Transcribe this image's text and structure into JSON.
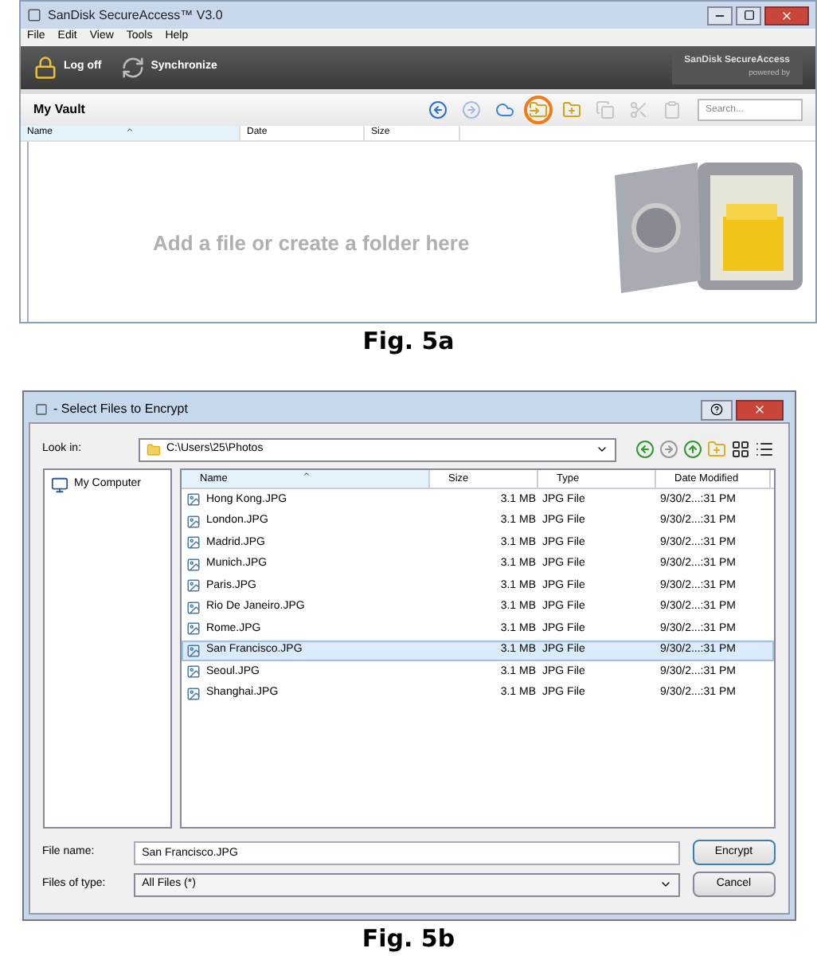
{
  "fig_a": {
    "window": {
      "title": "SanDisk SecureAccess™ V3.0"
    },
    "menu": [
      "File",
      "Edit",
      "View",
      "Tools",
      "Help"
    ],
    "toolbar": [
      {
        "label": "Log off",
        "kind": "lock"
      },
      {
        "label": "Synchronize",
        "kind": "sync"
      }
    ],
    "brand": {
      "name": "SanDisk SecureAccess",
      "tagline": "powered by"
    },
    "vault": {
      "title": "My Vault",
      "tools": [
        {
          "kind": "back",
          "disabled": false,
          "highlighted": false
        },
        {
          "kind": "forward",
          "disabled": true,
          "highlighted": false
        },
        {
          "kind": "cloud",
          "disabled": false,
          "highlighted": false
        },
        {
          "kind": "folder_add",
          "disabled": false,
          "highlighted": true
        },
        {
          "kind": "folder_new",
          "disabled": false,
          "highlighted": false
        },
        {
          "kind": "copy",
          "disabled": true,
          "highlighted": false
        },
        {
          "kind": "cut",
          "disabled": true,
          "highlighted": false
        },
        {
          "kind": "paste",
          "disabled": true,
          "highlighted": false
        }
      ],
      "search": {
        "placeholder": "Search..."
      },
      "columns": [
        {
          "label": "Name",
          "sorted": true
        },
        {
          "label": "Date",
          "sorted": false
        },
        {
          "label": "Size",
          "sorted": false
        }
      ],
      "empty_message": "Add a file or create a folder here"
    },
    "caption": "Fig. 5a"
  },
  "fig_b": {
    "window": {
      "title": "- Select Files to Encrypt"
    },
    "look_in": {
      "label": "Look in:",
      "value": "C:\\Users\\25\\Photos"
    },
    "nav": [
      {
        "kind": "back"
      },
      {
        "kind": "forward"
      },
      {
        "kind": "up"
      },
      {
        "kind": "new_folder"
      },
      {
        "kind": "grid"
      },
      {
        "kind": "list"
      }
    ],
    "places": [
      {
        "label": "My Computer"
      }
    ],
    "columns": [
      {
        "label": "Name",
        "sorted": true
      },
      {
        "label": "Size",
        "sorted": false
      },
      {
        "label": "Type",
        "sorted": false
      },
      {
        "label": "Date Modified",
        "sorted": false
      }
    ],
    "rows": [
      {
        "name": "Hong Kong.JPG",
        "size": "3.1 MB",
        "type": "JPG File",
        "modified": "9/30/2...:31 PM",
        "selected": false
      },
      {
        "name": "London.JPG",
        "size": "3.1 MB",
        "type": "JPG File",
        "modified": "9/30/2...:31 PM",
        "selected": false
      },
      {
        "name": "Madrid.JPG",
        "size": "3.1 MB",
        "type": "JPG File",
        "modified": "9/30/2...:31 PM",
        "selected": false
      },
      {
        "name": "Munich.JPG",
        "size": "3.1 MB",
        "type": "JPG File",
        "modified": "9/30/2...:31 PM",
        "selected": false
      },
      {
        "name": "Paris.JPG",
        "size": "3.1 MB",
        "type": "JPG File",
        "modified": "9/30/2...:31 PM",
        "selected": false
      },
      {
        "name": "Rio De Janeiro.JPG",
        "size": "3.1 MB",
        "type": "JPG File",
        "modified": "9/30/2...:31 PM",
        "selected": false
      },
      {
        "name": "Rome.JPG",
        "size": "3.1 MB",
        "type": "JPG File",
        "modified": "9/30/2...:31 PM",
        "selected": false
      },
      {
        "name": "San Francisco.JPG",
        "size": "3.1 MB",
        "type": "JPG File",
        "modified": "9/30/2...:31 PM",
        "selected": true
      },
      {
        "name": "Seoul.JPG",
        "size": "3.1 MB",
        "type": "JPG File",
        "modified": "9/30/2...:31 PM",
        "selected": false
      },
      {
        "name": "Shanghai.JPG",
        "size": "3.1 MB",
        "type": "JPG File",
        "modified": "9/30/2...:31 PM",
        "selected": false
      }
    ],
    "file_name": {
      "label": "File name:",
      "value": "San Francisco.JPG"
    },
    "file_type": {
      "label": "Files of type:",
      "value": "All Files (*)"
    },
    "buttons": [
      {
        "label": "Encrypt",
        "kind": "primary"
      },
      {
        "label": "Cancel",
        "kind": "secondary"
      }
    ],
    "caption": "Fig. 5b"
  }
}
